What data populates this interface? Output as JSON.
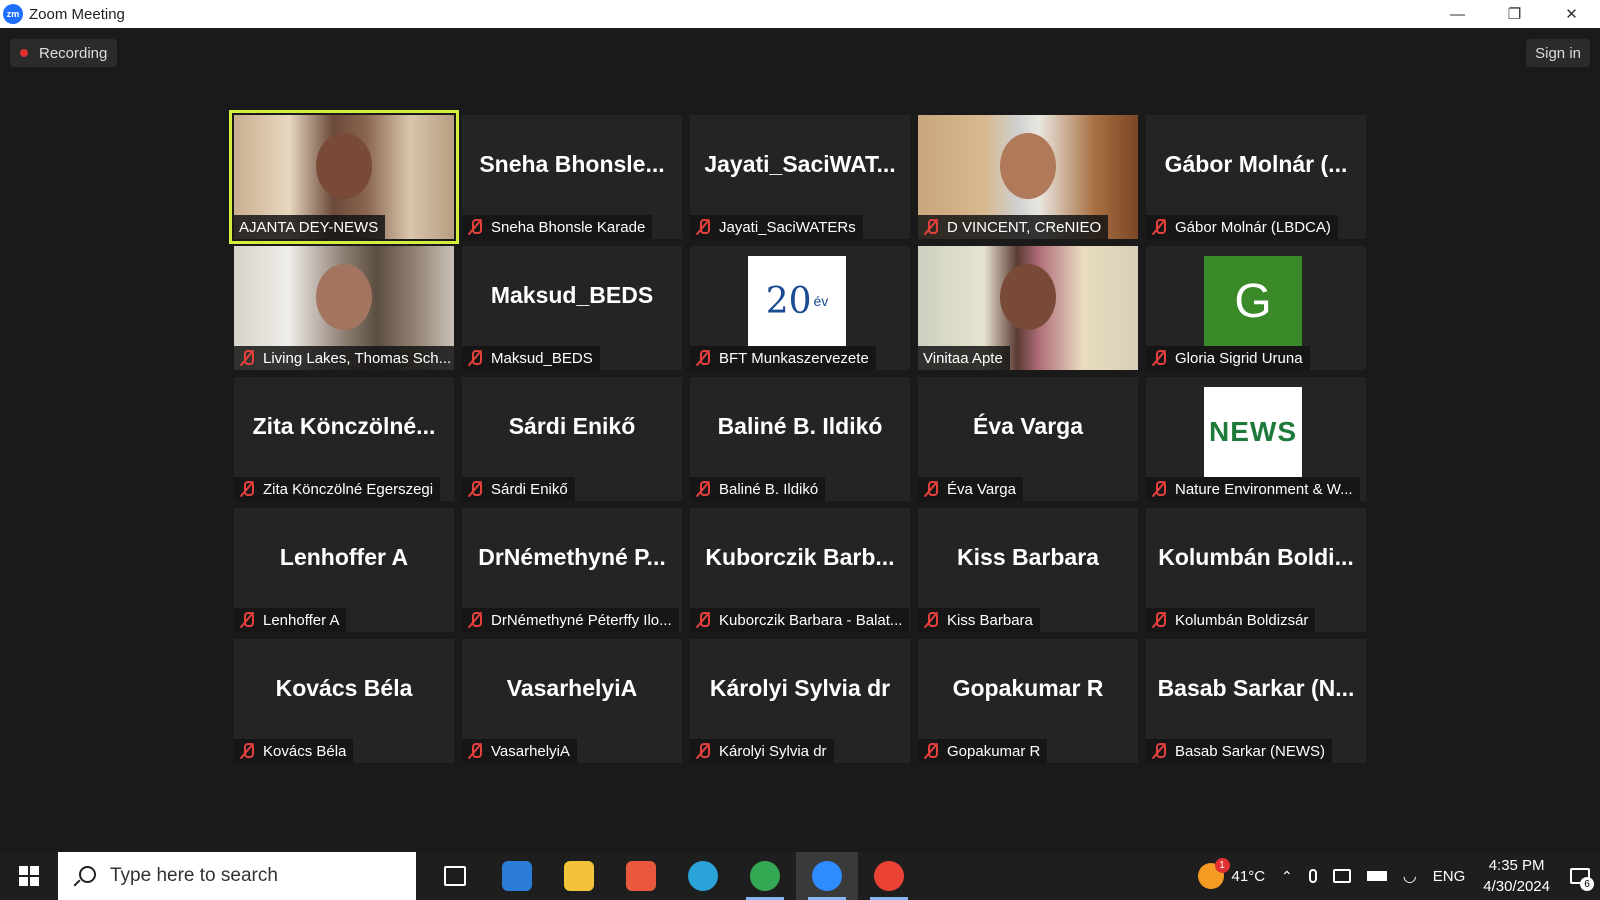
{
  "window": {
    "logo": "zm",
    "title": "Zoom Meeting",
    "controls": {
      "minimize": "—",
      "restore": "❐",
      "close": "✕"
    }
  },
  "topbar": {
    "recording_label": "Recording",
    "sign_in_label": "Sign in"
  },
  "participants": [
    {
      "big": "",
      "tag": "AJANTA DEY-NEWS",
      "video": "ajanta",
      "muted": false,
      "active": true
    },
    {
      "big": "Sneha  Bhonsle...",
      "tag": "Sneha Bhonsle Karade",
      "muted": true
    },
    {
      "big": "Jayati_SaciWAT...",
      "tag": "Jayati_SaciWATERs",
      "muted": true
    },
    {
      "big": "",
      "tag": "D VINCENT, CReNIEO",
      "video": "vincent",
      "muted": true
    },
    {
      "big": "Gábor  Molnár  (...",
      "tag": "Gábor Molnár (LBDCA)",
      "muted": true
    },
    {
      "big": "",
      "tag": "Living Lakes, Thomas Sch...",
      "video": "living",
      "muted": true
    },
    {
      "big": "Maksud_BEDS",
      "tag": "Maksud_BEDS",
      "muted": true
    },
    {
      "big": "",
      "tag": "BFT Munkaszervezete",
      "logo": "bft",
      "logo_text": "20",
      "logo_sub": "év",
      "muted": true
    },
    {
      "big": "",
      "tag": "Vinitaa Apte",
      "video": "vinitaa",
      "muted": false
    },
    {
      "big": "",
      "tag": "Gloria Sigrid Uruna",
      "logo": "g",
      "logo_text": "G",
      "muted": true
    },
    {
      "big": "Zita  Könczölné...",
      "tag": "Zita Könczölné Egerszegi",
      "muted": true
    },
    {
      "big": "Sárdi Enikő",
      "tag": "Sárdi Enikő",
      "muted": true
    },
    {
      "big": "Baliné B. Ildikó",
      "tag": "Baliné B. Ildikó",
      "muted": true
    },
    {
      "big": "Éva Varga",
      "tag": "Éva Varga",
      "muted": true
    },
    {
      "big": "",
      "tag": "Nature Environment & W...",
      "logo": "news",
      "logo_text": "NEWS",
      "muted": true
    },
    {
      "big": "Lenhoffer A",
      "tag": "Lenhoffer A",
      "muted": true
    },
    {
      "big": "DrNémethyné  P...",
      "tag": "DrNémethyné Péterffy Ilo...",
      "muted": true
    },
    {
      "big": "Kuborczik  Barb...",
      "tag": "Kuborczik Barbara - Balat...",
      "muted": true
    },
    {
      "big": "Kiss Barbara",
      "tag": "Kiss Barbara",
      "muted": true
    },
    {
      "big": "Kolumbán  Boldi...",
      "tag": "Kolumbán Boldizsár",
      "muted": true
    },
    {
      "big": "Kovács Béla",
      "tag": "Kovács Béla",
      "muted": true
    },
    {
      "big": "VasarhelyiA",
      "tag": "VasarhelyiA",
      "muted": true
    },
    {
      "big": "Károlyi Sylvia dr",
      "tag": "Károlyi Sylvia dr",
      "muted": true
    },
    {
      "big": "Gopakumar R",
      "tag": "Gopakumar R",
      "muted": true
    },
    {
      "big": "Basab  Sarkar  (N...",
      "tag": "Basab Sarkar (NEWS)",
      "muted": true
    }
  ],
  "taskbar": {
    "search_placeholder": "Type here to search",
    "apps": [
      {
        "name": "task-view-icon",
        "color": "#ffffff",
        "running": false,
        "active": false
      },
      {
        "name": "mail-icon",
        "color": "#2b7bd9",
        "running": false,
        "active": false
      },
      {
        "name": "file-explorer-icon",
        "color": "#f3c33b",
        "running": false,
        "active": false
      },
      {
        "name": "microsoft-store-icon",
        "color": "#e9573f",
        "running": false,
        "active": false
      },
      {
        "name": "edge-icon",
        "color": "#2aa3d8",
        "running": false,
        "active": false
      },
      {
        "name": "chrome-icon",
        "color": "#34a853",
        "running": true,
        "active": false
      },
      {
        "name": "zoom-icon",
        "color": "#2d8cff",
        "running": true,
        "active": true
      },
      {
        "name": "chrome-profile-icon",
        "color": "#ea4335",
        "running": true,
        "active": false
      }
    ],
    "weather_badge": "1",
    "temperature": "41°C",
    "language": "ENG",
    "time": "4:35 PM",
    "date": "4/30/2024",
    "notification_count": "6"
  }
}
